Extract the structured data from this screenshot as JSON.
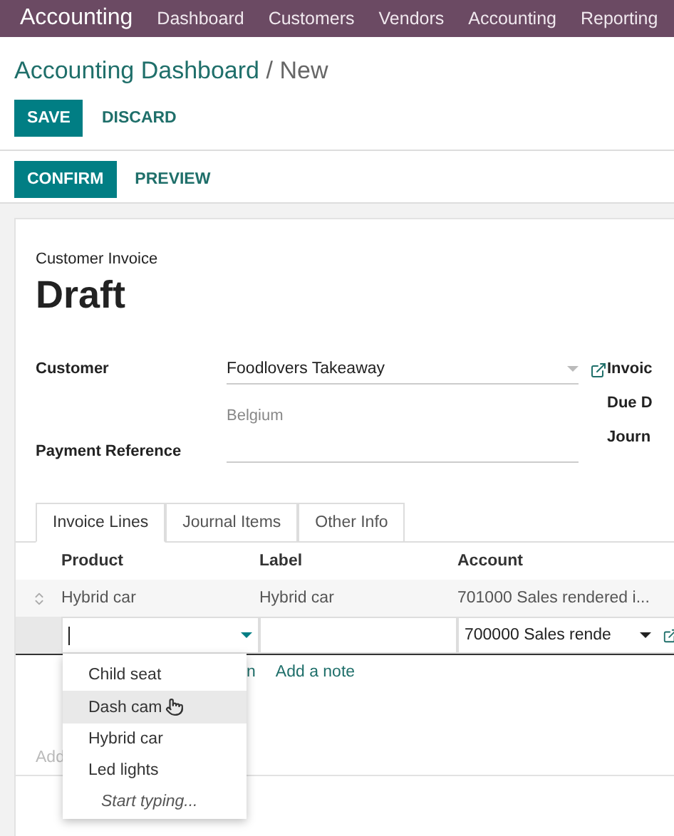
{
  "app": {
    "name": "Accounting",
    "menu": [
      "Dashboard",
      "Customers",
      "Vendors",
      "Accounting",
      "Reporting"
    ]
  },
  "breadcrumb": {
    "parent": "Accounting Dashboard",
    "separator": "/",
    "current": "New"
  },
  "actions": [
    {
      "label": "SAVE",
      "primary": true
    },
    {
      "label": "DISCARD",
      "primary": false
    }
  ],
  "status_actions": [
    {
      "label": "CONFIRM",
      "primary": true
    },
    {
      "label": "PREVIEW",
      "primary": false
    }
  ],
  "form": {
    "subtitle": "Customer Invoice",
    "title": "Draft",
    "customer": {
      "label": "Customer",
      "value": "Foodlovers Takeaway",
      "address": "Belgium"
    },
    "payment_reference": {
      "label": "Payment Reference"
    },
    "right_labels": [
      "Invoic",
      "Due D",
      "Journ"
    ]
  },
  "tabs": [
    {
      "label": "Invoice Lines",
      "selected": true
    },
    {
      "label": "Journal Items",
      "selected": false
    },
    {
      "label": "Other Info",
      "selected": false
    }
  ],
  "table": {
    "columns": [
      "Product",
      "Label",
      "Account"
    ],
    "rows": [
      {
        "kind": "line",
        "product": "Hybrid car",
        "label": "Hybrid car",
        "account": "701000 Sales rendered i..."
      },
      {
        "kind": "edit",
        "product": "",
        "label": "",
        "account": "700000 Sales rende"
      }
    ],
    "add_links": [
      "n",
      "Add a note"
    ],
    "footer_hint": "Add"
  },
  "dropdown": {
    "options": [
      {
        "label": "Child seat",
        "selected": false
      },
      {
        "label": "Dash cam",
        "selected": true
      },
      {
        "label": "Hybrid car",
        "selected": false
      },
      {
        "label": "Led lights",
        "selected": false
      }
    ],
    "hint": "Start typing..."
  }
}
